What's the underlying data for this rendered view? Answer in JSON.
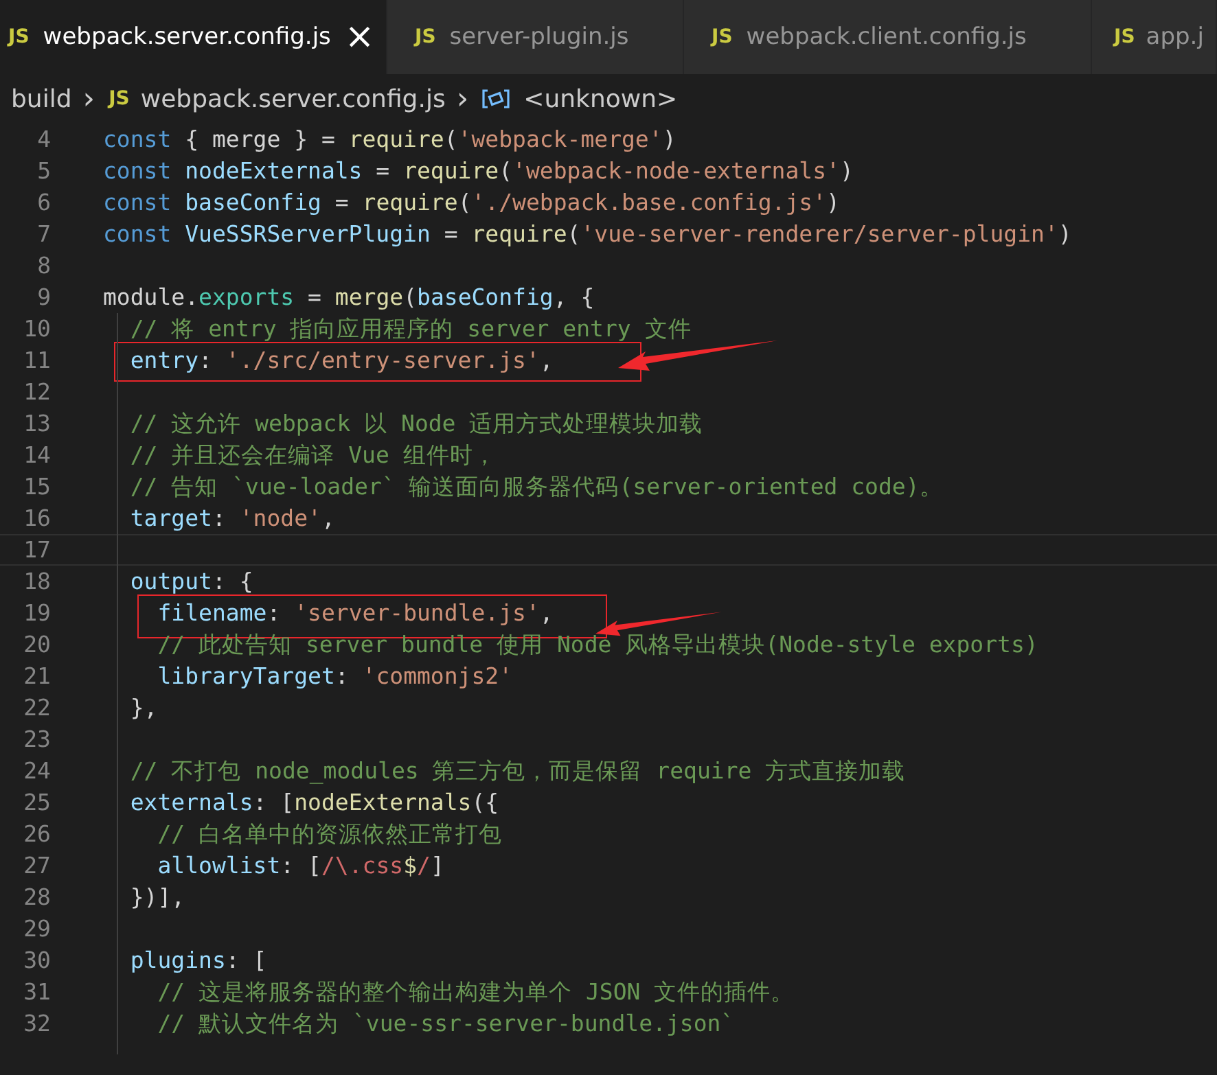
{
  "tabs": [
    {
      "icon": "JS",
      "label": "webpack.server.config.js",
      "selected": true,
      "close": "×"
    },
    {
      "icon": "JS",
      "label": "server-plugin.js",
      "selected": false
    },
    {
      "icon": "JS",
      "label": "webpack.client.config.js",
      "selected": false
    },
    {
      "icon": "JS",
      "label": "app.j",
      "selected": false
    }
  ],
  "breadcrumb": [
    {
      "kind": "folder",
      "label": "build"
    },
    {
      "kind": "file",
      "icon": "JS",
      "label": "webpack.server.config.js"
    },
    {
      "kind": "symbol",
      "label": "<unknown>"
    }
  ],
  "breadcrumb_separator": "›",
  "lines": [
    {
      "number": "4",
      "current": false,
      "boxed": false,
      "tokens": [
        {
          "kind": "keyword",
          "t": "const"
        },
        {
          "kind": "plain",
          "t": " { merge } = "
        },
        {
          "kind": "function",
          "t": "require"
        },
        {
          "kind": "plain",
          "t": "("
        },
        {
          "kind": "string",
          "t": "'webpack-merge'"
        },
        {
          "kind": "plain",
          "t": ")"
        }
      ]
    },
    {
      "number": "5",
      "current": false,
      "boxed": false,
      "tokens": [
        {
          "kind": "keyword",
          "t": "const"
        },
        {
          "kind": "variable",
          "t": " nodeExternals"
        },
        {
          "kind": "plain",
          "t": " = "
        },
        {
          "kind": "function",
          "t": "require"
        },
        {
          "kind": "plain",
          "t": "("
        },
        {
          "kind": "string",
          "t": "'webpack-node-externals'"
        },
        {
          "kind": "plain",
          "t": ")"
        }
      ]
    },
    {
      "number": "6",
      "current": false,
      "boxed": false,
      "tokens": [
        {
          "kind": "keyword",
          "t": "const"
        },
        {
          "kind": "variable",
          "t": " baseConfig"
        },
        {
          "kind": "plain",
          "t": " = "
        },
        {
          "kind": "function",
          "t": "require"
        },
        {
          "kind": "plain",
          "t": "("
        },
        {
          "kind": "string",
          "t": "'./webpack.base.config.js'"
        },
        {
          "kind": "plain",
          "t": ")"
        }
      ]
    },
    {
      "number": "7",
      "current": false,
      "boxed": false,
      "tokens": [
        {
          "kind": "keyword",
          "t": "const"
        },
        {
          "kind": "variable",
          "t": " VueSSRServerPlugin"
        },
        {
          "kind": "plain",
          "t": " = "
        },
        {
          "kind": "function",
          "t": "require"
        },
        {
          "kind": "plain",
          "t": "("
        },
        {
          "kind": "string",
          "t": "'vue-server-renderer/server-plugin'"
        },
        {
          "kind": "plain",
          "t": ")"
        }
      ]
    },
    {
      "number": "8",
      "current": false,
      "boxed": false
    },
    {
      "number": "9",
      "current": false,
      "boxed": false,
      "tokens": [
        {
          "kind": "plain",
          "t": "module."
        },
        {
          "kind": "type",
          "t": "exports"
        },
        {
          "kind": "plain",
          "t": " = "
        },
        {
          "kind": "function",
          "t": "merge"
        },
        {
          "kind": "plain",
          "t": "("
        },
        {
          "kind": "variable",
          "t": "baseConfig"
        },
        {
          "kind": "plain",
          "t": ", {"
        }
      ]
    },
    {
      "number": "10",
      "current": false,
      "boxed": false,
      "tokens": [
        {
          "kind": "comment",
          "t": "  // 将 entry 指向应用程序的 server entry 文件"
        }
      ]
    },
    {
      "number": "11",
      "current": false,
      "boxed": true,
      "tokens": [
        {
          "kind": "variable",
          "t": "  entry"
        },
        {
          "kind": "plain",
          "t": ": "
        },
        {
          "kind": "string",
          "t": "'./src/entry-server.js'"
        },
        {
          "kind": "plain",
          "t": ","
        }
      ]
    },
    {
      "number": "12",
      "current": false,
      "boxed": false
    },
    {
      "number": "13",
      "current": false,
      "boxed": false,
      "tokens": [
        {
          "kind": "comment",
          "t": "  // 这允许 webpack 以 Node 适用方式处理模块加载"
        }
      ]
    },
    {
      "number": "14",
      "current": false,
      "boxed": false,
      "tokens": [
        {
          "kind": "comment",
          "t": "  // 并且还会在编译 Vue 组件时，"
        }
      ]
    },
    {
      "number": "15",
      "current": false,
      "boxed": false,
      "tokens": [
        {
          "kind": "comment",
          "t": "  // 告知 `vue-loader` 输送面向服务器代码(server-oriented code)。"
        }
      ]
    },
    {
      "number": "16",
      "current": false,
      "boxed": false,
      "tokens": [
        {
          "kind": "variable",
          "t": "  target"
        },
        {
          "kind": "plain",
          "t": ": "
        },
        {
          "kind": "string",
          "t": "'node'"
        },
        {
          "kind": "plain",
          "t": ","
        }
      ]
    },
    {
      "number": "17",
      "current": true,
      "boxed": false
    },
    {
      "number": "18",
      "current": false,
      "boxed": false,
      "tokens": [
        {
          "kind": "variable",
          "t": "  output"
        },
        {
          "kind": "plain",
          "t": ": {"
        }
      ]
    },
    {
      "number": "19",
      "current": false,
      "boxed": true,
      "tokens": [
        {
          "kind": "variable",
          "t": "    filename"
        },
        {
          "kind": "plain",
          "t": ": "
        },
        {
          "kind": "string",
          "t": "'server-bundle.js'"
        },
        {
          "kind": "plain",
          "t": ","
        }
      ]
    },
    {
      "number": "20",
      "current": false,
      "boxed": false,
      "tokens": [
        {
          "kind": "comment",
          "t": "    // 此处告知 server bundle 使用 Node 风格导出模块(Node-style exports)"
        }
      ]
    },
    {
      "number": "21",
      "current": false,
      "boxed": false,
      "tokens": [
        {
          "kind": "variable",
          "t": "    libraryTarget"
        },
        {
          "kind": "plain",
          "t": ": "
        },
        {
          "kind": "string",
          "t": "'commonjs2'"
        }
      ]
    },
    {
      "number": "22",
      "current": false,
      "boxed": false,
      "tokens": [
        {
          "kind": "plain",
          "t": "  },"
        }
      ]
    },
    {
      "number": "23",
      "current": false,
      "boxed": false
    },
    {
      "number": "24",
      "current": false,
      "boxed": false,
      "tokens": [
        {
          "kind": "comment",
          "t": "  // 不打包 node_modules 第三方包，而是保留 require 方式直接加载"
        }
      ]
    },
    {
      "number": "25",
      "current": false,
      "boxed": false,
      "tokens": [
        {
          "kind": "variable",
          "t": "  externals"
        },
        {
          "kind": "plain",
          "t": ": ["
        },
        {
          "kind": "function",
          "t": "nodeExternals"
        },
        {
          "kind": "plain",
          "t": "({"
        }
      ]
    },
    {
      "number": "26",
      "current": false,
      "boxed": false,
      "tokens": [
        {
          "kind": "comment",
          "t": "    // 白名单中的资源依然正常打包"
        }
      ]
    },
    {
      "number": "27",
      "current": false,
      "boxed": false,
      "tokens": [
        {
          "kind": "variable",
          "t": "    allowlist"
        },
        {
          "kind": "plain",
          "t": ": ["
        },
        {
          "kind": "regex",
          "t": "/\\.css"
        },
        {
          "kind": "function",
          "t": "$"
        },
        {
          "kind": "regex",
          "t": "/"
        },
        {
          "kind": "plain",
          "t": "]"
        }
      ]
    },
    {
      "number": "28",
      "current": false,
      "boxed": false,
      "tokens": [
        {
          "kind": "plain",
          "t": "  })],"
        }
      ]
    },
    {
      "number": "29",
      "current": false,
      "boxed": false
    },
    {
      "number": "30",
      "current": false,
      "boxed": false,
      "tokens": [
        {
          "kind": "variable",
          "t": "  plugins"
        },
        {
          "kind": "plain",
          "t": ": ["
        }
      ]
    },
    {
      "number": "31",
      "current": false,
      "boxed": false,
      "tokens": [
        {
          "kind": "comment",
          "t": "    // 这是将服务器的整个输出构建为单个 JSON 文件的插件。"
        }
      ]
    },
    {
      "number": "32",
      "current": false,
      "boxed": false,
      "tokens": [
        {
          "kind": "comment",
          "t": "    // 默认文件名为 `vue-ssr-server-bundle.json`"
        }
      ]
    }
  ]
}
